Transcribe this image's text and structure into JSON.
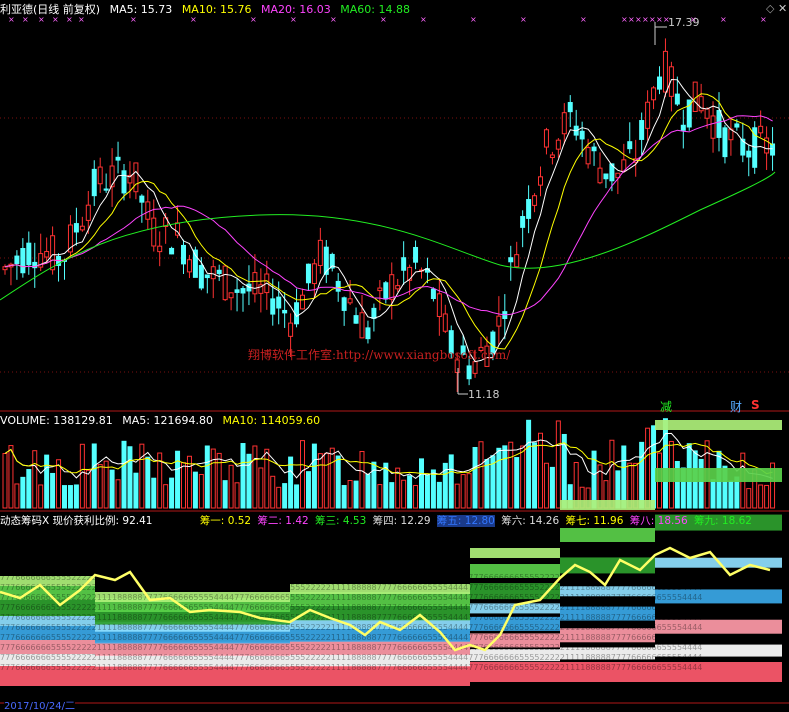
{
  "main_panel": {
    "title": "利亚德(日线 前复权)",
    "indicators": [
      {
        "label": "MA5: 15.73",
        "color": "#ffffff"
      },
      {
        "label": "MA10: 15.76",
        "color": "#ffff00"
      },
      {
        "label": "MA20: 16.03",
        "color": "#ff44ff"
      },
      {
        "label": "MA60: 14.88",
        "color": "#22ee22"
      }
    ],
    "high_label": "17.39",
    "low_label": "11.18",
    "watermark": "翔博软件工作室:http://www.xiangbosoft.com/",
    "tags": {
      "jian": "减",
      "cai": "财",
      "s": "S"
    },
    "colors": {
      "up": "#ff3232",
      "down": "#54ffff",
      "ma5": "#ffffff",
      "ma10": "#ffff00",
      "ma20": "#ff44ff",
      "ma60": "#22ee22"
    }
  },
  "volume_panel": {
    "indicators": [
      {
        "label": "VOLUME: 138129.81",
        "color": "#ffffff"
      },
      {
        "label": "MA5: 121694.80",
        "color": "#ffffff"
      },
      {
        "label": "MA10: 114059.60",
        "color": "#ffff00"
      }
    ]
  },
  "chip_panel": {
    "indicators": [
      {
        "label": "动态筹码X 现价获利比例: 92.41",
        "color": "#ffffff"
      },
      {
        "label": "筹一: 0.52",
        "color": "#ffff00"
      },
      {
        "label": "筹二: 1.42",
        "color": "#ff44ff"
      },
      {
        "label": "筹三: 4.53",
        "color": "#22ee22"
      },
      {
        "label": "筹四: 12.29",
        "color": "#dddddd"
      },
      {
        "label": "筹五: 12.80",
        "color": "#3377ff"
      },
      {
        "label": "筹六: 14.26",
        "color": "#dddddd"
      },
      {
        "label": "筹七: 11.96",
        "color": "#ffff00"
      },
      {
        "label": "筹八: 18.56",
        "color": "#ff44ff"
      },
      {
        "label": "筹九: 18.62",
        "color": "#22ee22"
      }
    ]
  },
  "footer": {
    "date": "2017/10/24/二"
  },
  "chart_data": {
    "type": "candlestick",
    "y_range": [
      11.18,
      17.39
    ],
    "high_value": 17.39,
    "low_value": 11.18,
    "last_ma": {
      "ma5": 15.73,
      "ma10": 15.76,
      "ma20": 16.03,
      "ma60": 14.88
    },
    "volume_last": {
      "volume": 138129.81,
      "ma5": 121694.8,
      "ma10": 114059.6
    },
    "chip_profit_ratio": 92.41,
    "chip_levels": [
      0.52,
      1.42,
      4.53,
      12.29,
      12.8,
      14.26,
      11.96,
      18.56,
      18.62
    ]
  }
}
